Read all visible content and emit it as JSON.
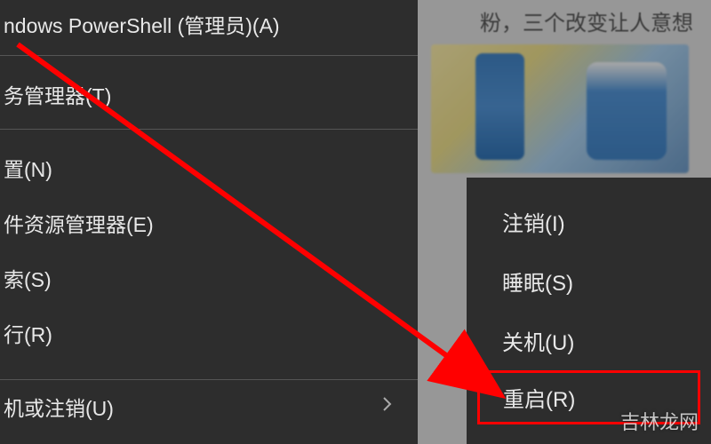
{
  "background": {
    "headline_text": "粉，三个改变让人意想"
  },
  "main_menu": {
    "items": [
      {
        "label": "ndows PowerShell (管理员)(A)"
      },
      {
        "label": "务管理器(T)"
      },
      {
        "label": "置(N)"
      },
      {
        "label": "件资源管理器(E)"
      },
      {
        "label": "索(S)"
      },
      {
        "label": "行(R)"
      }
    ],
    "shutdown_item": {
      "label": "机或注销(U)"
    }
  },
  "submenu": {
    "items": [
      {
        "label": "注销(I)"
      },
      {
        "label": "睡眠(S)"
      },
      {
        "label": "关机(U)"
      },
      {
        "label": "重启(R)"
      }
    ]
  },
  "annotation": {
    "arrow_color": "#ff0000",
    "highlight_color": "#ff0000"
  },
  "watermark": "吉林龙网"
}
